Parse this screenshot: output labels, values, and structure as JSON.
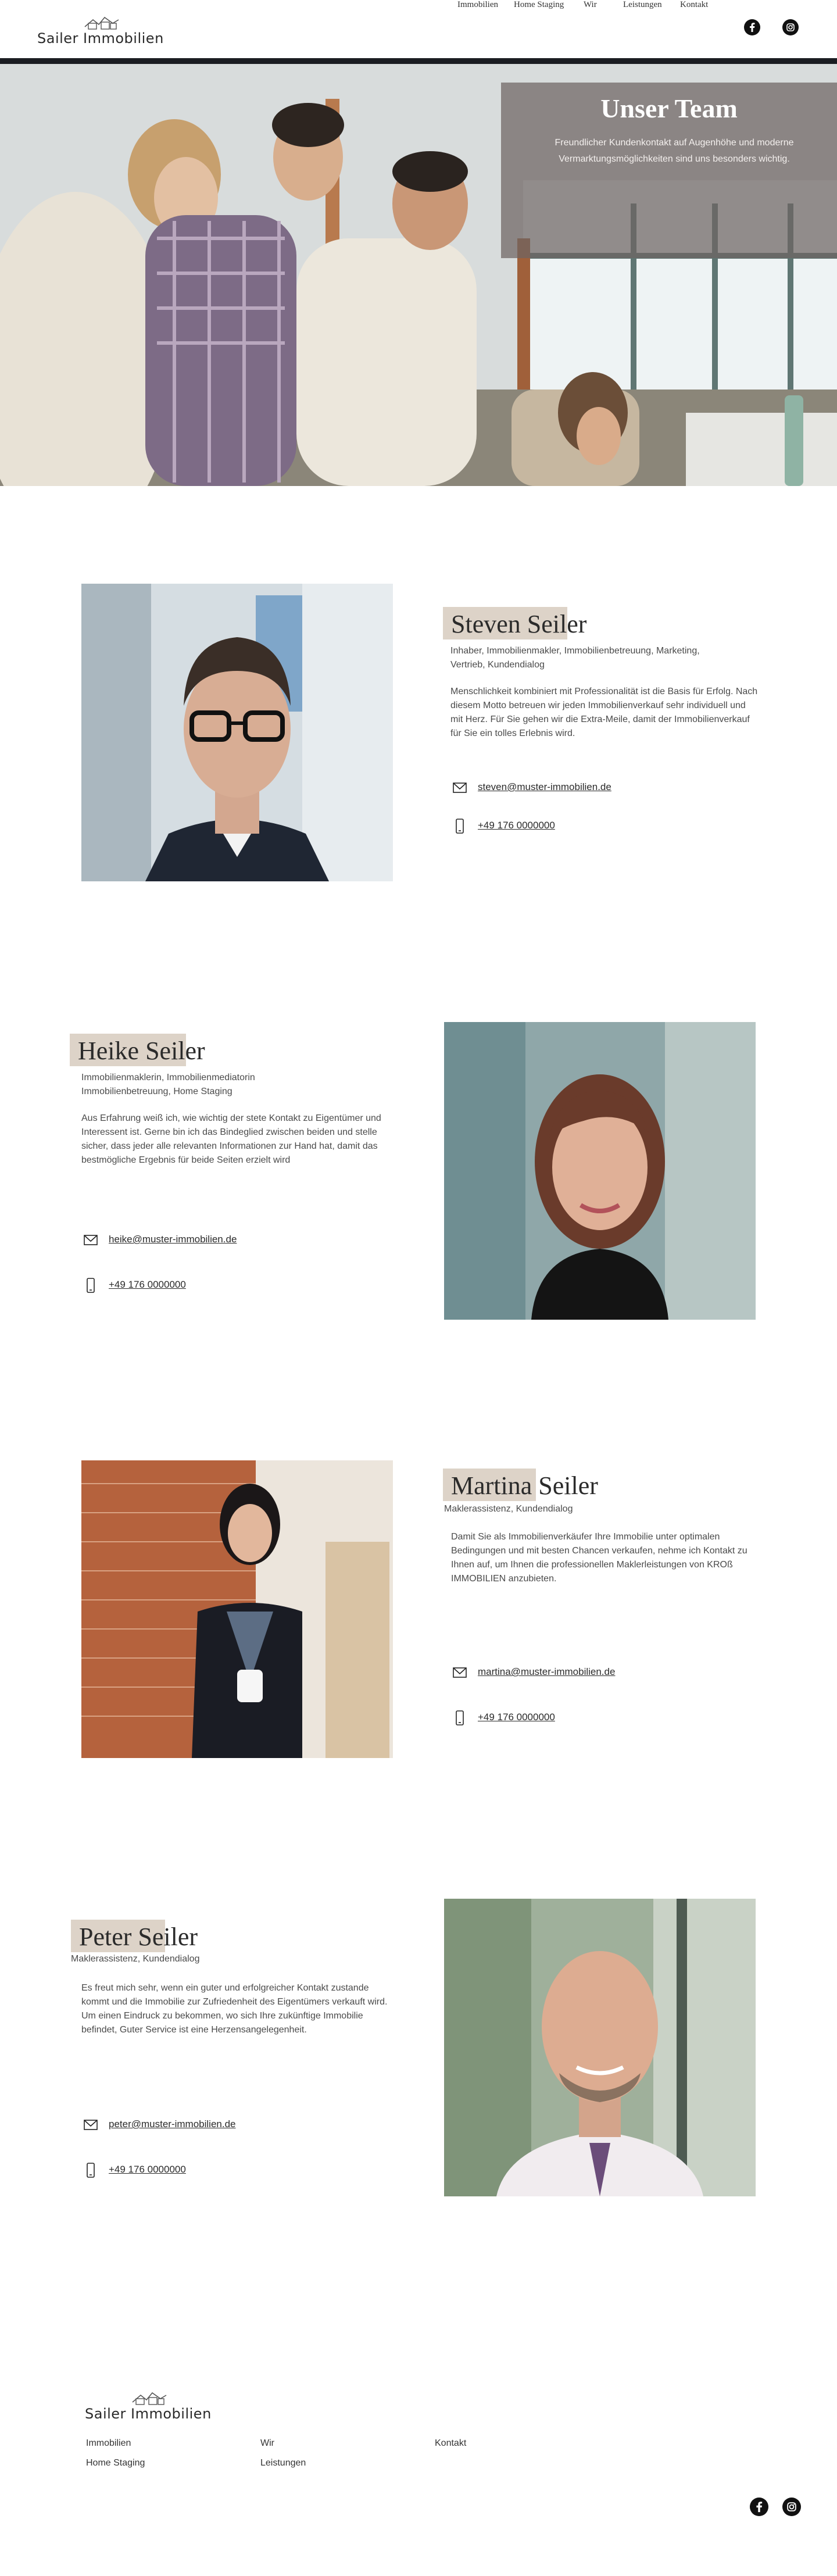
{
  "header": {
    "logo_text": "Sailer Immobilien",
    "nav": [
      "Immobilien",
      "Home Staging",
      "Wir",
      "Leistungen",
      "Kontakt"
    ],
    "social": [
      "facebook-icon",
      "instagram-icon"
    ]
  },
  "hero": {
    "title": "Unser Team",
    "subtitle": "Freundlicher Kundenkontakt auf Augenhöhe und moderne Vermarktungsmöglichkeiten sind uns besonders wichtig."
  },
  "members": [
    {
      "first": "Steven",
      "last": "Seiler",
      "role": "Inhaber, Immobilienmakler, Immobilienbetreuung, Marketing, Vertrieb, Kundendialog",
      "text": "Menschlichkeit kombiniert mit Professionalität ist die Basis für Erfolg. Nach diesem Motto betreuen wir jeden Immobilienverkauf sehr individuell und mit Herz. Für Sie gehen wir die Extra-Meile, damit der Immobilienverkauf für Sie ein tolles Erlebnis wird.",
      "email": "steven@muster-immobilien.de",
      "phone": "+49 176 0000000"
    },
    {
      "first": "Heike",
      "last": "Seiler",
      "role": "Immobilienmaklerin, Immobilienmediatorin Immobilienbetreuung, Home Staging",
      "text": "Aus Erfahrung weiß ich, wie wichtig der stete Kontakt zu Eigentümer und Interessent ist. Gerne bin ich das Bindeglied zwischen beiden und stelle sicher, dass jeder alle relevanten Informationen zur Hand hat, damit das bestmögliche Ergebnis für beide Seiten erzielt wird",
      "email": "heike@muster-immobilien.de",
      "phone": "+49 176 0000000"
    },
    {
      "first": "Martina",
      "last": "Seiler",
      "role": "Maklerassistenz, Kundendialog",
      "text": "Damit Sie als Immobilienverkäufer Ihre Immobilie unter optimalen Bedingungen und mit besten Chancen verkaufen, nehme ich Kontakt zu Ihnen auf, um Ihnen die professionellen Maklerleistungen von KROß IMMOBILIEN anzubieten.",
      "email": "martina@muster-immobilien.de",
      "phone": "+49 176 0000000"
    },
    {
      "first": "Peter",
      "last": "Seiler",
      "role": "Maklerassistenz, Kundendialog",
      "text": "Es freut mich sehr, wenn ein guter und erfolgreicher Kontakt zustande kommt und die Immobilie zur Zufriedenheit des Eigentümers verkauft wird. Um einen Eindruck zu bekommen, wo sich Ihre zukünftige Immobilie befindet, Guter Service ist eine Herzensangelegenheit.",
      "email": "peter@muster-immobilien.de",
      "phone": "+49 176 0000000"
    }
  ],
  "footer": {
    "logo_text": "Sailer Immobilien",
    "links": [
      "Immobilien",
      "Wir",
      "Kontakt",
      "Home Staging",
      "Leistungen"
    ]
  },
  "colors": {
    "accent_highlight": "#ddd3c8",
    "hero_overlay": "#6e6462",
    "header_bar": "#1b1d22"
  }
}
